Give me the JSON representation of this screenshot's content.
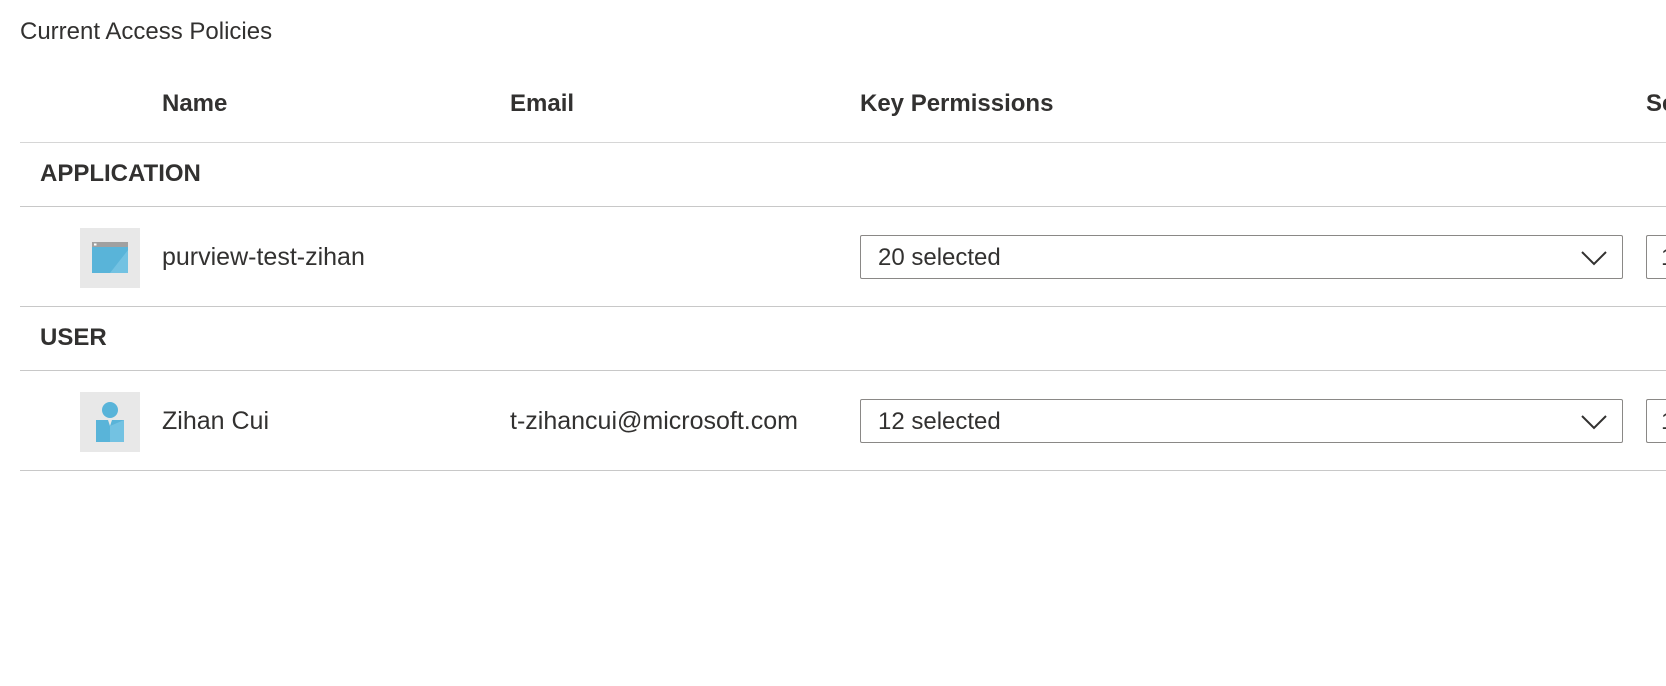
{
  "section": {
    "title": "Current Access Policies"
  },
  "table": {
    "columns": {
      "name": "Name",
      "email": "Email",
      "key_permissions": "Key Permissions",
      "secret_permissions_partial": "Se"
    },
    "groups": [
      {
        "label": "APPLICATION",
        "rows": [
          {
            "icon": "application-icon",
            "name": "purview-test-zihan",
            "email": "",
            "key_permissions": "20 selected",
            "secret_permissions_partial": "1"
          }
        ]
      },
      {
        "label": "USER",
        "rows": [
          {
            "icon": "user-icon",
            "name": "Zihan Cui",
            "email": "t-zihancui@microsoft.com",
            "key_permissions": "12 selected",
            "secret_permissions_partial": "1"
          }
        ]
      }
    ]
  },
  "colors": {
    "accent": "#59b4d9",
    "accent_light": "#7fc8e6",
    "text": "#323130",
    "border": "#8a8886",
    "divider": "#c8c8c8"
  }
}
